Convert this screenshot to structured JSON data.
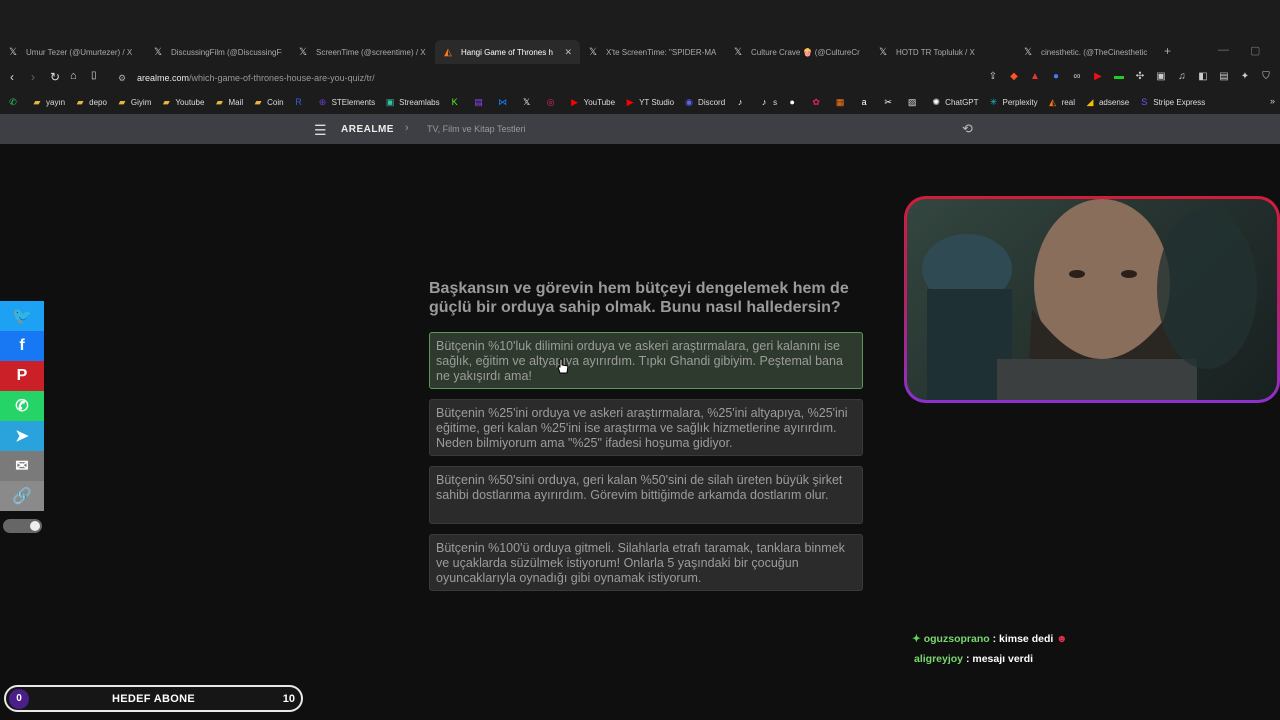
{
  "browser": {
    "tabs": [
      {
        "icon": "x-icon",
        "label": "Umur Tezer (@Umurtezer) / X",
        "active": false
      },
      {
        "icon": "x-icon",
        "label": "DiscussingFilm (@DiscussingFi",
        "active": false
      },
      {
        "icon": "x-icon",
        "label": "ScreenTime (@screentime) / X",
        "active": false
      },
      {
        "icon": "fox-icon",
        "label": "Hangi Game of Thrones h",
        "active": true
      },
      {
        "icon": "x-icon",
        "label": "X'te ScreenTime: \"SPIDER-MA",
        "active": false
      },
      {
        "icon": "x-icon",
        "label": "Culture Crave 🍿 (@CultureCr",
        "active": false
      },
      {
        "icon": "x-icon",
        "label": "HOTD TR Topluluk / X",
        "active": false
      },
      {
        "icon": "x-icon",
        "label": "cinesthetic. (@TheCinesthetic",
        "active": false
      }
    ],
    "url_host": "arealme.com",
    "url_path": "/which-game-of-thrones-house-are-you-quiz/tr/",
    "bookmarks": [
      {
        "icon": "whatsapp-icon",
        "label": "",
        "color": "#25d366"
      },
      {
        "icon": "folder-icon",
        "label": "yayın",
        "color": "#e8b33e"
      },
      {
        "icon": "folder-icon",
        "label": "depo",
        "color": "#e8b33e"
      },
      {
        "icon": "folder-icon",
        "label": "Giyim",
        "color": "#e8b33e"
      },
      {
        "icon": "folder-icon",
        "label": "Youtube",
        "color": "#e8b33e"
      },
      {
        "icon": "folder-icon",
        "label": "Mail",
        "color": "#e8b33e"
      },
      {
        "icon": "folder-icon",
        "label": "Coin",
        "color": "#e8b33e"
      },
      {
        "icon": "r-icon",
        "label": "",
        "color": "#3b5bdb"
      },
      {
        "icon": "st-icon",
        "label": "STElements",
        "color": "#6c3bd1"
      },
      {
        "icon": "streamlabs-icon",
        "label": "Streamlabs",
        "color": "#31c3a2"
      },
      {
        "icon": "k-icon",
        "label": "",
        "color": "#53fc18"
      },
      {
        "icon": "twitch-icon",
        "label": "",
        "color": "#9146ff"
      },
      {
        "icon": "bluesky-icon",
        "label": "",
        "color": "#1185fe"
      },
      {
        "icon": "x-icon",
        "label": "",
        "color": "#ffffff"
      },
      {
        "icon": "instagram-icon",
        "label": "",
        "color": "#e1306c"
      },
      {
        "icon": "youtube-icon",
        "label": "YouTube",
        "color": "#ff0000"
      },
      {
        "icon": "yt-studio-icon",
        "label": "YT Studio",
        "color": "#ff0000"
      },
      {
        "icon": "discord-icon",
        "label": "Discord",
        "color": "#5865f2"
      },
      {
        "icon": "tiktok-icon",
        "label": "",
        "color": "#ffffff"
      },
      {
        "icon": "tiktok-icon",
        "label": "s",
        "color": "#ffffff"
      },
      {
        "icon": "circle-icon",
        "label": "",
        "color": "#ffffff"
      },
      {
        "icon": "pinwheel-icon",
        "label": "",
        "color": "#e91e63"
      },
      {
        "icon": "orange-icon",
        "label": "",
        "color": "#ff7a1a"
      },
      {
        "icon": "amazon-icon",
        "label": "",
        "color": "#ffffff"
      },
      {
        "icon": "tools-icon",
        "label": "",
        "color": "#ffffff"
      },
      {
        "icon": "image-icon",
        "label": "",
        "color": "#dddddd"
      },
      {
        "icon": "chatgpt-icon",
        "label": "ChatGPT",
        "color": "#ffffff"
      },
      {
        "icon": "perplexity-icon",
        "label": "Perplexity",
        "color": "#20b8cd"
      },
      {
        "icon": "fox-icon",
        "label": "real",
        "color": "#ff7a1a"
      },
      {
        "icon": "adsense-icon",
        "label": "adsense",
        "color": "#fbbc04"
      },
      {
        "icon": "stripe-icon",
        "label": "Stripe Express",
        "color": "#635bff"
      }
    ]
  },
  "site": {
    "brand": "AREALME",
    "breadcrumb": "TV, Film ve Kitap Testleri"
  },
  "quiz": {
    "question": "Başkansın ve görevin hem bütçeyi dengelemek hem de güçlü bir orduya sahip olmak. Bunu nasıl halledersin?",
    "answers": [
      {
        "text": "Bütçenin %10'luk dilimini orduya ve askeri araştırmalara, geri kalanını ise sağlık, eğitim ve altyapıya ayırırdım. Tıpkı Ghandi gibiyim. Peştemal bana ne yakışırdı ama!",
        "selected": true
      },
      {
        "text": "Bütçenin %25'ini orduya ve askeri araştırmalara, %25'ini altyapıya, %25'ini eğitime, geri kalan %25'ini ise araştırma ve sağlık hizmetlerine ayırırdım. Neden bilmiyorum ama \"%25\" ifadesi hoşuma gidiyor.",
        "selected": false
      },
      {
        "text": "Bütçenin %50'sini orduya, geri kalan %50'sini de silah üreten büyük şirket sahibi dostlarıma ayırırdım. Görevim bittiğimde arkamda dostlarım olur.",
        "selected": false
      },
      {
        "text": "Bütçenin %100'ü orduya gitmeli. Silahlarla etrafı taramak, tanklara binmek ve uçaklarda süzülmek istiyorum! Onlarla 5 yaşındaki bir çocuğun oyuncaklarıyla oynadığı gibi oynamak istiyorum.",
        "selected": false
      }
    ]
  },
  "share": [
    {
      "icon": "twitter-icon",
      "color": "#1da1f2"
    },
    {
      "icon": "facebook-icon",
      "color": "#1877f2"
    },
    {
      "icon": "pinterest-icon",
      "color": "#cb2027"
    },
    {
      "icon": "whatsapp-icon",
      "color": "#25d366"
    },
    {
      "icon": "telegram-icon",
      "color": "#2aa3dd"
    },
    {
      "icon": "email-icon",
      "color": "#7a7a7a"
    },
    {
      "icon": "link-icon",
      "color": "#8a8a8a"
    }
  ],
  "stream": {
    "chat": [
      {
        "user": "oguzsoprano",
        "message": "kimse dedi",
        "badge": "star-badge-icon",
        "emote": "devil-emote-icon"
      },
      {
        "user": "aligreyjoy",
        "message": "mesajı verdi",
        "badge": "",
        "emote": ""
      }
    ],
    "goal": {
      "label": "HEDEF ABONE",
      "current": "0",
      "target": "10",
      "progress": 0
    }
  }
}
